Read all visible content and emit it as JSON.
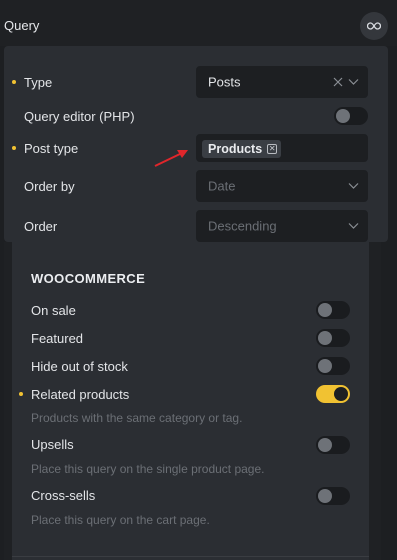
{
  "header": {
    "title": "Query"
  },
  "query": {
    "type": {
      "label": "Type",
      "value": "Posts"
    },
    "query_editor": {
      "label": "Query editor (PHP)",
      "enabled": false
    },
    "post_type": {
      "label": "Post type",
      "tags": [
        "Products"
      ]
    },
    "order_by": {
      "label": "Order by",
      "placeholder": "Date"
    },
    "order": {
      "label": "Order",
      "placeholder": "Descending"
    }
  },
  "woocommerce": {
    "title": "WOOCOMMERCE",
    "on_sale": {
      "label": "On sale",
      "enabled": false
    },
    "featured": {
      "label": "Featured",
      "enabled": false
    },
    "hide_out_of_stock": {
      "label": "Hide out of stock",
      "enabled": false
    },
    "related_products": {
      "label": "Related products",
      "enabled": true,
      "hint": "Products with the same category or tag."
    },
    "upsells": {
      "label": "Upsells",
      "enabled": false,
      "hint": "Place this query on the single product page."
    },
    "cross_sells": {
      "label": "Cross-sells",
      "enabled": false,
      "hint": "Place this query on the cart page."
    }
  },
  "colors": {
    "accent": "#f1c232",
    "annotation_arrow": "#e0262b",
    "panel": "#2b2e33",
    "input": "#1d1f22"
  },
  "icons": {
    "loop": "infinity-icon",
    "chevron": "chevron-down-icon",
    "clear": "close-icon",
    "tag_remove": "close-box-icon"
  }
}
